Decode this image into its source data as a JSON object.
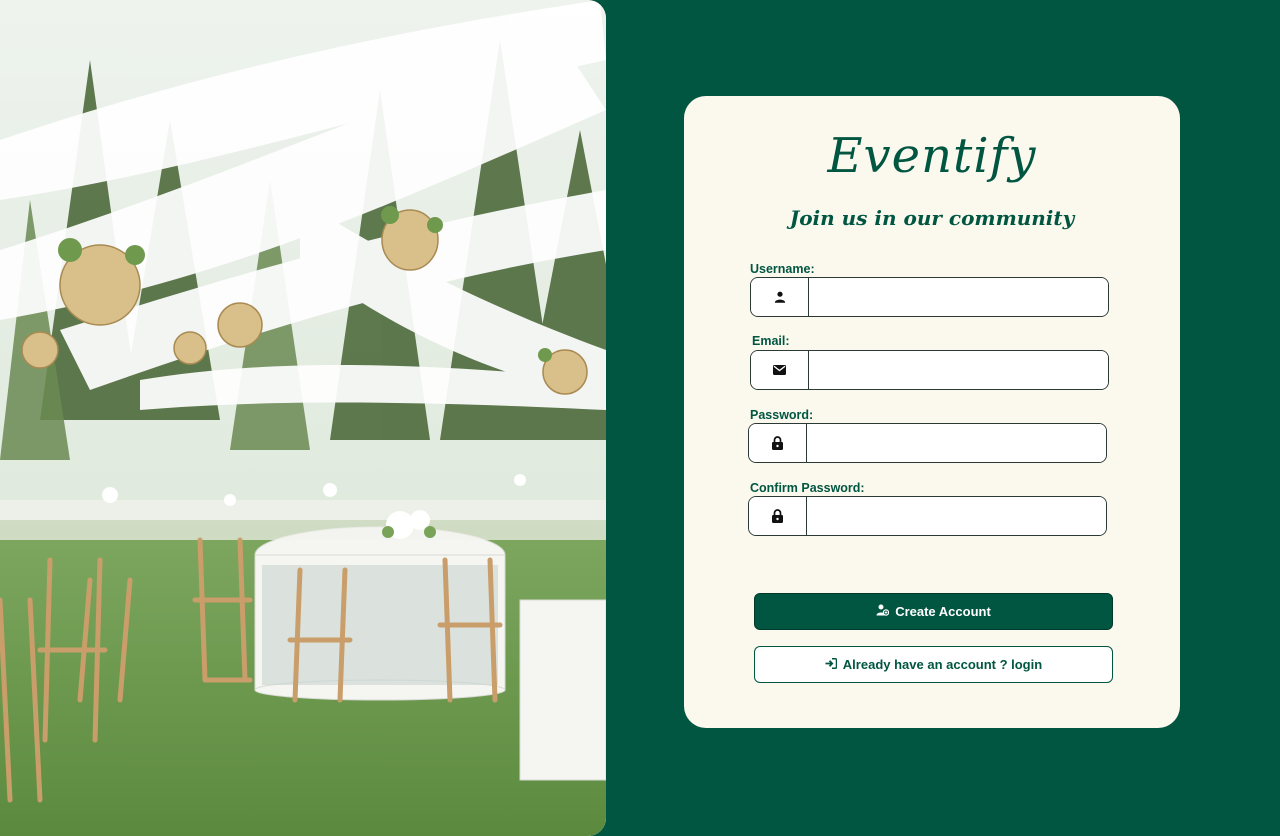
{
  "brand": {
    "logo": "Eventify",
    "tagline": "Join us in our community"
  },
  "form": {
    "username": {
      "label": "Username:",
      "icon": "user-icon",
      "value": "",
      "placeholder": ""
    },
    "email": {
      "label": "Email:",
      "icon": "envelope-icon",
      "value": "",
      "placeholder": ""
    },
    "password": {
      "label": "Password:",
      "icon": "lock-icon",
      "value": "",
      "placeholder": ""
    },
    "confirm_password": {
      "label": "Confirm Password:",
      "icon": "lock-icon",
      "value": "",
      "placeholder": ""
    }
  },
  "buttons": {
    "create_account": "Create Account",
    "login": "Already have an account ? login"
  },
  "colors": {
    "primary": "#015641",
    "card": "#fbf8ee"
  }
}
